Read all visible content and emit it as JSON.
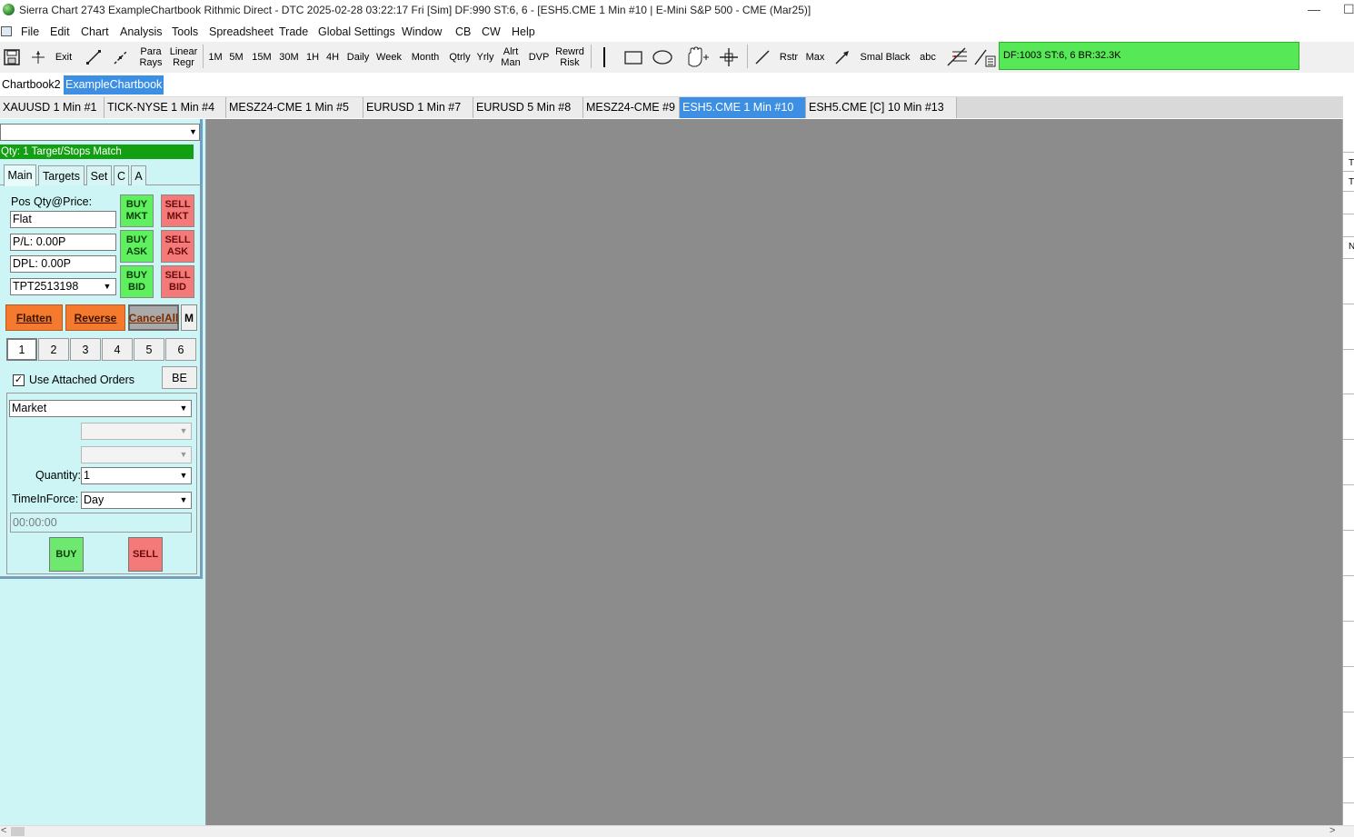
{
  "window": {
    "title": "Sierra Chart 2743 ExampleChartbook Rithmic Direct - DTC 2025-02-28  03:22:17 Fri [Sim] DF:990  ST:6, 6 - [ESH5.CME  1 Min  #10 | E-Mini S&P 500 - CME (Mar25)]",
    "minimize": "—",
    "maximize": "☐"
  },
  "menu": [
    "File",
    "Edit",
    "Chart",
    "Analysis",
    "Tools",
    "Spreadsheet",
    "Trade",
    "Global Settings",
    "Window",
    "CB",
    "CW",
    "Help"
  ],
  "toolbar": {
    "exit": "Exit",
    "para_rays": [
      "Para",
      "Rays"
    ],
    "linear_regr": [
      "Linear",
      "Regr"
    ],
    "timeframes": [
      "1M",
      "5M",
      "15M",
      "30M",
      "1H",
      "4H",
      "Daily",
      "Week",
      "Month",
      "Qtrly",
      "Yrly"
    ],
    "alrt_man": [
      "Alrt",
      "Man"
    ],
    "dvp": "DVP",
    "rewrd_risk": [
      "Rewrd",
      "Risk"
    ],
    "rstr": "Rstr",
    "max": "Max",
    "smal_black": "Smal Black",
    "abc": "abc",
    "status": "DF:1003  ST:6, 6  BR:32.3K"
  },
  "chartbook_tabs": [
    {
      "label": "Chartbook2",
      "active": false
    },
    {
      "label": "ExampleChartbook",
      "active": true
    }
  ],
  "chart_tabs": [
    {
      "label": "XAUUSD  1 Min  #1",
      "active": false
    },
    {
      "label": "TICK-NYSE  1 Min  #4",
      "active": false
    },
    {
      "label": "MESZ24-CME  1 Min  #5",
      "active": false
    },
    {
      "label": "EURUSD  1 Min  #7",
      "active": false
    },
    {
      "label": "EURUSD  5 Min  #8",
      "active": false
    },
    {
      "label": "MESZ24-CME  #9",
      "active": false
    },
    {
      "label": "ESH5.CME  1 Min  #10",
      "active": true
    },
    {
      "label": "ESH5.CME [C]  10 Min  #13",
      "active": false
    }
  ],
  "trade_window": {
    "symbol_value": "",
    "qty_status": "Qty: 1 Target/Stops Match",
    "tabs": [
      "Main",
      "Targets",
      "Set",
      "C",
      "A"
    ],
    "pos_label": "Pos Qty@Price:",
    "pos_value": "Flat",
    "pl_value": "P/L: 0.00P",
    "dpl_value": "DPL: 0.00P",
    "account": "TPT2513198",
    "buy_mkt": [
      "BUY",
      "MKT"
    ],
    "sell_mkt": [
      "SELL",
      "MKT"
    ],
    "buy_ask": [
      "BUY",
      "ASK"
    ],
    "sell_ask": [
      "SELL",
      "ASK"
    ],
    "buy_bid": [
      "BUY",
      "BID"
    ],
    "sell_bid": [
      "SELL",
      "BID"
    ],
    "flatten": "Flatten",
    "reverse": "Reverse",
    "cancel_all": "CancelAll",
    "m": "M",
    "number_buttons": [
      "1",
      "2",
      "3",
      "4",
      "5",
      "6"
    ],
    "use_attached_orders": "Use Attached Orders",
    "use_attached_checked": "✓",
    "be": "BE",
    "order_type": "Market",
    "quantity_label": "Quantity:",
    "quantity_value": "1",
    "tif_label": "TimeInForce:",
    "tif_value": "Day",
    "time_value": "00:00:00",
    "buy": "BUY",
    "sell": "SELL"
  },
  "right_strip_chars": [
    "T",
    "T",
    "N"
  ],
  "scroll": {
    "left": "<",
    "right": ">"
  }
}
